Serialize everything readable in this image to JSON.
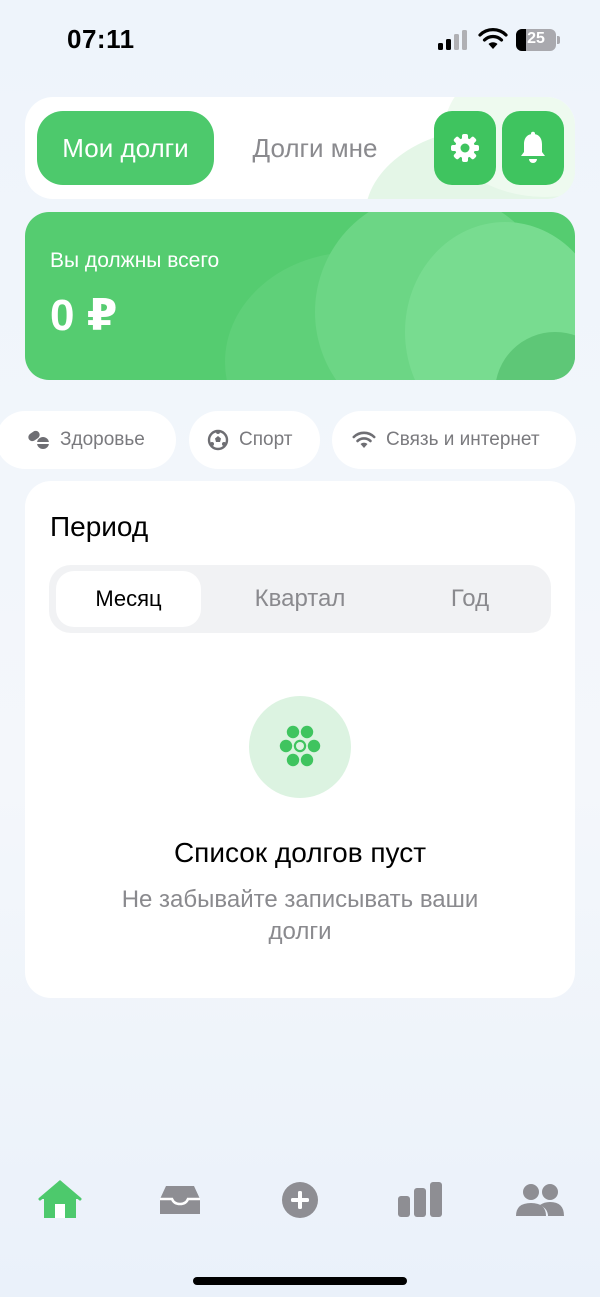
{
  "status_bar": {
    "time": "07:11",
    "battery_level": "25"
  },
  "header": {
    "tab_my_debts": "Мои долги",
    "tab_debts_to_me": "Долги мне",
    "active_tab": "Мои долги",
    "settings_icon": "gear-icon",
    "notifications_icon": "bell-icon"
  },
  "balance": {
    "label": "Вы должны всего",
    "value": "0 ₽"
  },
  "categories": [
    {
      "label": "Здоровье",
      "icon": "pills-icon"
    },
    {
      "label": "Спорт",
      "icon": "soccer-ball-icon"
    },
    {
      "label": "Связь и интернет",
      "icon": "wifi-icon"
    }
  ],
  "period": {
    "title": "Период",
    "options": [
      "Месяц",
      "Квартал",
      "Год"
    ],
    "selected": "Месяц"
  },
  "empty_state": {
    "icon": "dots-icon",
    "title": "Список долгов пуст",
    "subtitle": "Не забывайте записывать ваши долги"
  },
  "bottom_nav": {
    "items": [
      "home-icon",
      "inbox-icon",
      "add-icon",
      "stats-icon",
      "people-icon"
    ],
    "active": "home-icon"
  },
  "colors": {
    "accent": "#4dc96c",
    "muted_text": "#8a8a8e",
    "nav_inactive": "#8e8e93"
  }
}
